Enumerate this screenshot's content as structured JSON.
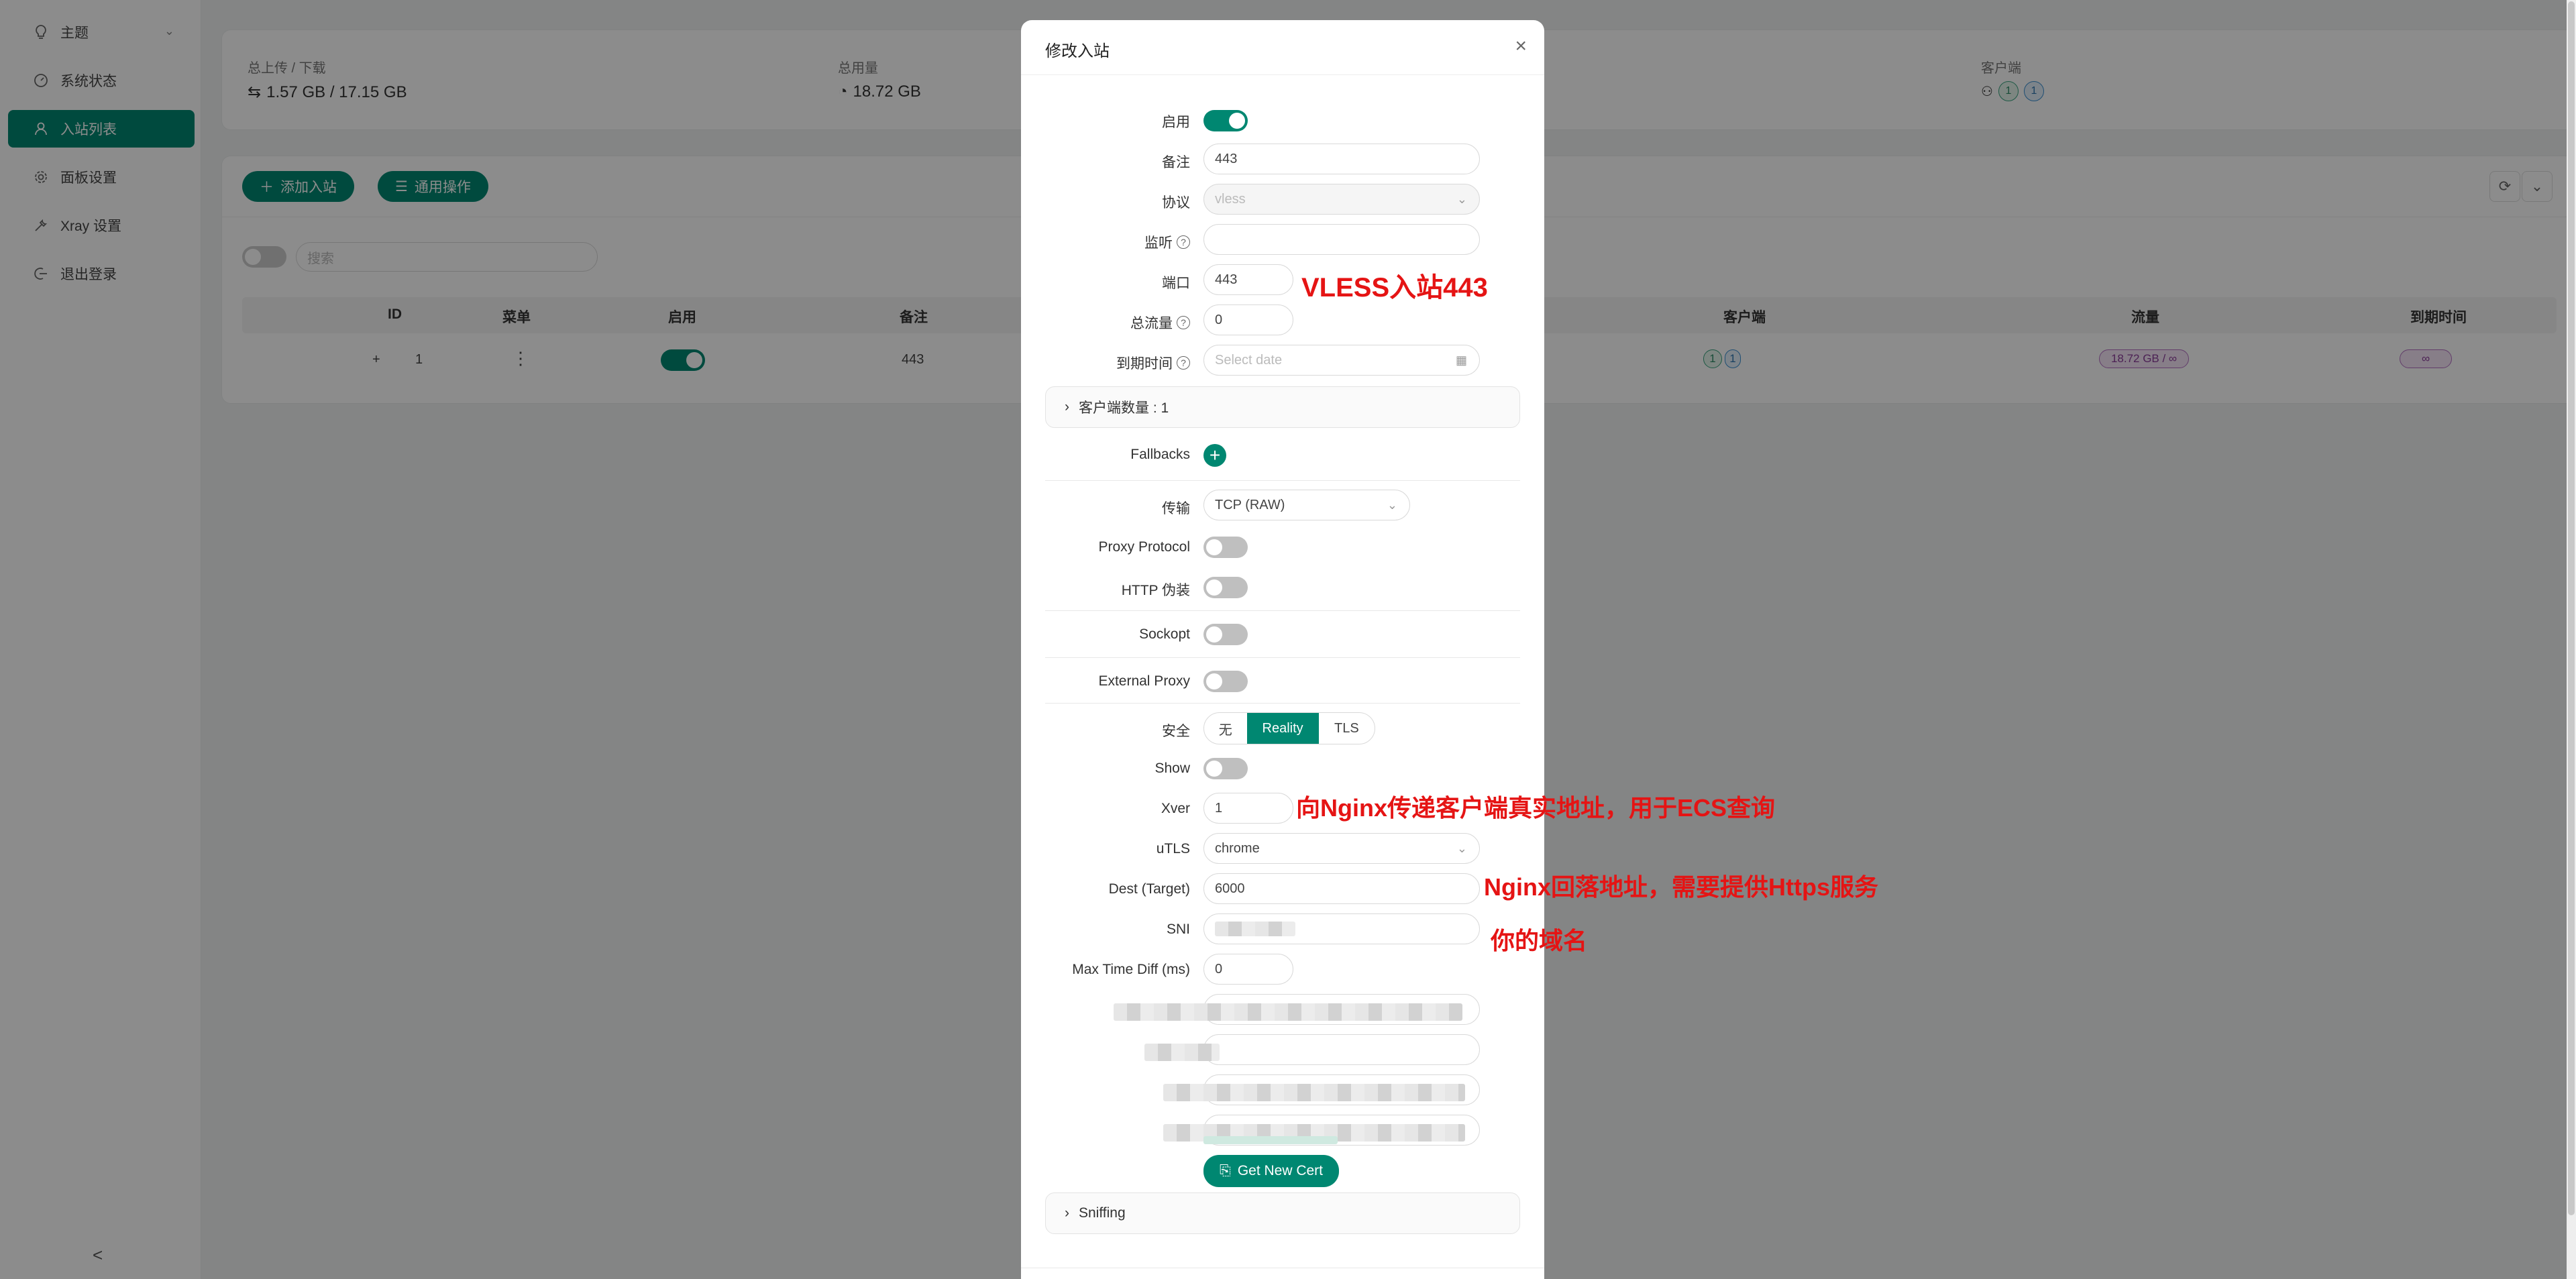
{
  "sidebar": {
    "items": [
      {
        "label": "主题",
        "icon": "bulb-icon"
      },
      {
        "label": "系统状态",
        "icon": "dashboard-icon"
      },
      {
        "label": "入站列表",
        "icon": "user-icon"
      },
      {
        "label": "面板设置",
        "icon": "gear-icon"
      },
      {
        "label": "Xray 设置",
        "icon": "tool-icon"
      },
      {
        "label": "退出登录",
        "icon": "logout-icon"
      }
    ],
    "collapse_glyph": "<"
  },
  "stats": {
    "upload_download_label": "总上传 / 下载",
    "upload_download_value": "1.57 GB / 17.15 GB",
    "total_traffic_label": "总用量",
    "total_traffic_value": "18.72 GB",
    "clients_label": "客户端",
    "clients_a": "1",
    "clients_b": "1"
  },
  "toolbar": {
    "add_inbound": "添加入站",
    "general_actions": "通用操作",
    "search_placeholder": "搜索"
  },
  "table": {
    "headers": {
      "id": "ID",
      "menu": "菜单",
      "enabled": "启用",
      "remark": "备注",
      "clients": "客户端",
      "traffic": "流量",
      "expiry": "到期时间"
    },
    "row": {
      "expand": "+",
      "id": "1",
      "menu": "⋮",
      "remark": "443",
      "client_a": "1",
      "client_b": "1",
      "traffic": "18.72 GB / ∞",
      "expiry": "∞"
    }
  },
  "modal": {
    "title": "修改入站",
    "close": "×",
    "labels": {
      "enable": "启用",
      "remark": "备注",
      "protocol": "协议",
      "listen": "监听",
      "port": "端口",
      "total_traffic": "总流量",
      "expiry": "到期时间",
      "fallbacks": "Fallbacks",
      "transport": "传输",
      "proxy_protocol": "Proxy Protocol",
      "http_camouflage": "HTTP 伪装",
      "sockopt": "Sockopt",
      "external_proxy": "External Proxy",
      "security": "安全",
      "show": "Show",
      "xver": "Xver",
      "utls": "uTLS",
      "dest": "Dest (Target)",
      "sni": "SNI",
      "max_time_diff": "Max Time Diff (ms)"
    },
    "values": {
      "remark": "443",
      "protocol": "vless",
      "listen": "",
      "port": "443",
      "total_traffic": "0",
      "expiry_placeholder": "Select date",
      "transport": "TCP (RAW)",
      "xver": "1",
      "utls": "chrome",
      "dest": "6000",
      "max_time_diff": "0"
    },
    "toggles": {
      "enable": true,
      "proxy_protocol": false,
      "http_camouflage": false,
      "sockopt": false,
      "external_proxy": false,
      "show": false
    },
    "clients_collapse": "客户端数量 : 1",
    "security_options": [
      "无",
      "Reality",
      "TLS"
    ],
    "security_selected": "Reality",
    "get_new_cert": "Get New Cert",
    "sniffing": "Sniffing"
  },
  "annotations": {
    "port_note": "VLESS入站443",
    "xver_note": "向Nginx传递客户端真实地址，用于ECS查询",
    "dest_note": "Nginx回落地址，需要提供Https服务",
    "sni_note": "你的域名"
  },
  "colors": {
    "accent": "#008771",
    "annotation": "#e51414"
  }
}
